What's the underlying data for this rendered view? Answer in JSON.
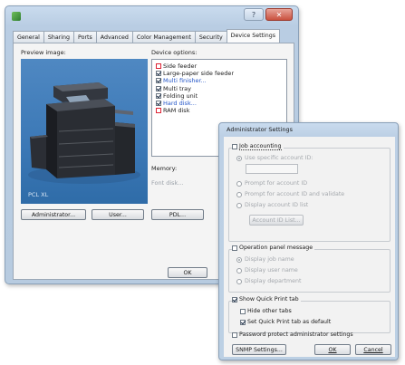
{
  "main_window": {
    "tabs": [
      {
        "label": "General"
      },
      {
        "label": "Sharing"
      },
      {
        "label": "Ports"
      },
      {
        "label": "Advanced"
      },
      {
        "label": "Color Management"
      },
      {
        "label": "Security"
      },
      {
        "label": "Device Settings"
      }
    ],
    "active_tab": "Device Settings",
    "preview_label": "Preview image:",
    "preview_caption": "PCL XL",
    "device_options_label": "Device options:",
    "device_options": [
      {
        "label": "Side feeder",
        "checked": false,
        "style": "normal"
      },
      {
        "label": "Large-paper side feeder",
        "checked": true,
        "style": "normal"
      },
      {
        "label": "Multi finisher...",
        "checked": true,
        "style": "link"
      },
      {
        "label": "Multi tray",
        "checked": true,
        "style": "normal"
      },
      {
        "label": "Folding unit",
        "checked": true,
        "style": "normal"
      },
      {
        "label": "Hard disk...",
        "checked": true,
        "style": "link"
      },
      {
        "label": "RAM disk",
        "checked": false,
        "style": "normal"
      }
    ],
    "memory_label": "Memory:",
    "font_label": "Font disk...",
    "buttons": {
      "administrator": "Administrator...",
      "user": "User...",
      "pdl": "PDL...",
      "ok": "OK"
    }
  },
  "admin_dialog": {
    "title": "Administrator Settings",
    "job_accounting": {
      "label": "Job accounting",
      "checked": false,
      "use_specific_account": "Use specific account ID:",
      "prompt_account": "Prompt for account ID",
      "prompt_validate": "Prompt for account ID and validate",
      "display_list": "Display account ID list",
      "account_list_button": "Account ID List..."
    },
    "operation_panel": {
      "label": "Operation panel message",
      "checked": false,
      "display_job": "Display job name",
      "display_user": "Display user name",
      "display_department": "Display department"
    },
    "quick_print": {
      "show_label": "Show Quick Print tab",
      "show_checked": true,
      "hide_other_label": "Hide other tabs",
      "hide_other_checked": false,
      "set_default_label": "Set Quick Print tab as default",
      "set_default_checked": true
    },
    "password_protect_label": "Password protect administrator settings",
    "password_protect_checked": false,
    "buttons": {
      "snmp": "SNMP Settings...",
      "ok": "OK",
      "cancel": "Cancel"
    }
  }
}
